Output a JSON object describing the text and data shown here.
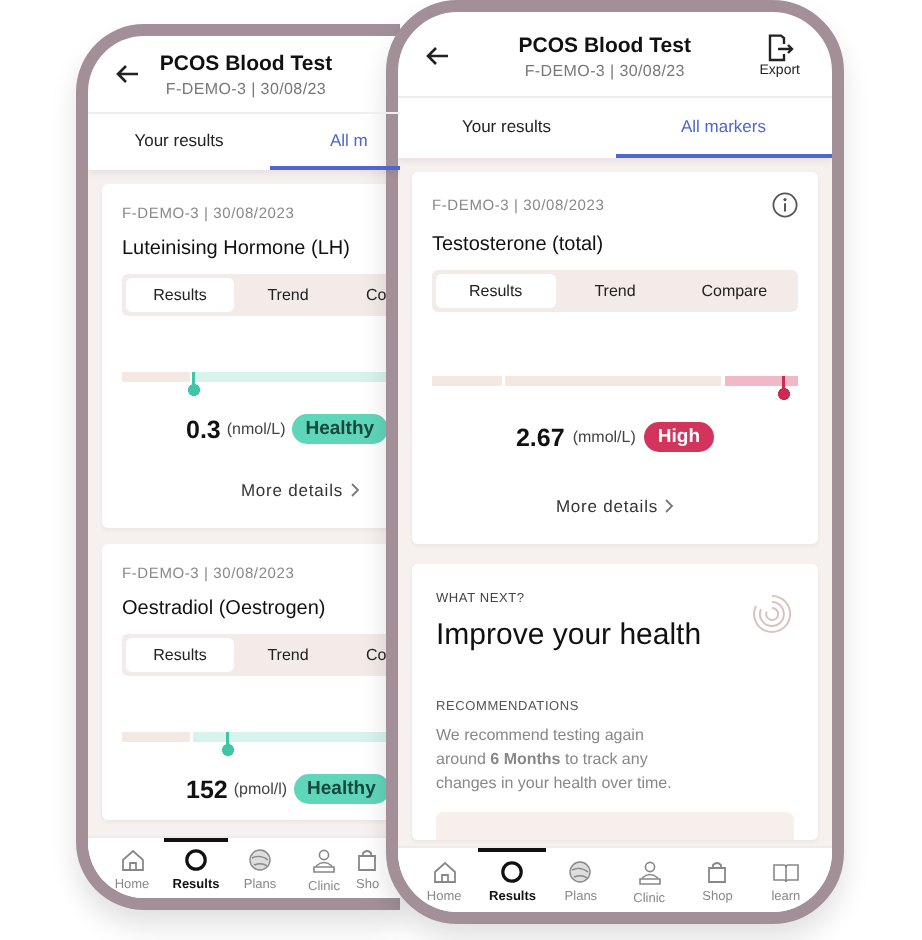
{
  "back_phone": {
    "header": {
      "title": "PCOS Blood Test",
      "subtitle": "F-DEMO-3 | 30/08/23"
    },
    "tabs": [
      {
        "label": "Your results",
        "selected": false
      },
      {
        "label": "All m",
        "selected": true
      }
    ],
    "cards": [
      {
        "meta": "F-DEMO-3 | 30/08/2023",
        "title": "Luteinising Hormone (LH)",
        "segments": [
          {
            "label": "Results",
            "selected": true
          },
          {
            "label": "Trend",
            "selected": false
          },
          {
            "label": "Co",
            "selected": false
          }
        ],
        "level": 0.2,
        "kind": "healthy",
        "value": "0.3",
        "unit": "(nmol/L)",
        "badge": "Healthy",
        "link": "More details"
      },
      {
        "meta": "F-DEMO-3 | 30/08/2023",
        "title": "Oestradiol (Oestrogen)",
        "segments": [
          {
            "label": "Results",
            "selected": true
          },
          {
            "label": "Trend",
            "selected": false
          },
          {
            "label": "Co",
            "selected": false
          }
        ],
        "level": 0.3,
        "kind": "healthy",
        "value": "152",
        "unit": "(pmol/l)",
        "badge": "Healthy"
      }
    ],
    "nav": [
      {
        "label": "Home",
        "selected": false
      },
      {
        "label": "Results",
        "selected": true
      },
      {
        "label": "Plans",
        "selected": false
      },
      {
        "label": "Clinic",
        "selected": false
      },
      {
        "label": "Sho",
        "selected": false
      }
    ]
  },
  "front_phone": {
    "header": {
      "title": "PCOS Blood Test",
      "subtitle": "F-DEMO-3 | 30/08/23",
      "action": "Export"
    },
    "tabs": [
      {
        "label": "Your results",
        "selected": false
      },
      {
        "label": "All markers",
        "selected": true
      }
    ],
    "cards": [
      {
        "meta": "F-DEMO-3 | 30/08/2023",
        "info": true,
        "title": "Testosterone (total)",
        "segments": [
          {
            "label": "Results",
            "selected": true
          },
          {
            "label": "Trend",
            "selected": false
          },
          {
            "label": "Compare",
            "selected": false
          }
        ],
        "level": 0.96,
        "kind": "high",
        "value": "2.67",
        "unit": "(mmol/L)",
        "badge": "High",
        "link": "More details"
      }
    ],
    "next": {
      "eyebrow": "WHAT NEXT?",
      "title": "Improve your health",
      "section": "RECOMMENDATIONS",
      "text": "We recommend testing again around **6 Months** to track any changes in your health over time."
    },
    "nav": [
      {
        "label": "Home",
        "selected": false
      },
      {
        "label": "Results",
        "selected": true
      },
      {
        "label": "Plans",
        "selected": false
      },
      {
        "label": "Clinic",
        "selected": false
      },
      {
        "label": "Shop",
        "selected": false
      },
      {
        "label": "learn",
        "selected": false
      }
    ]
  }
}
